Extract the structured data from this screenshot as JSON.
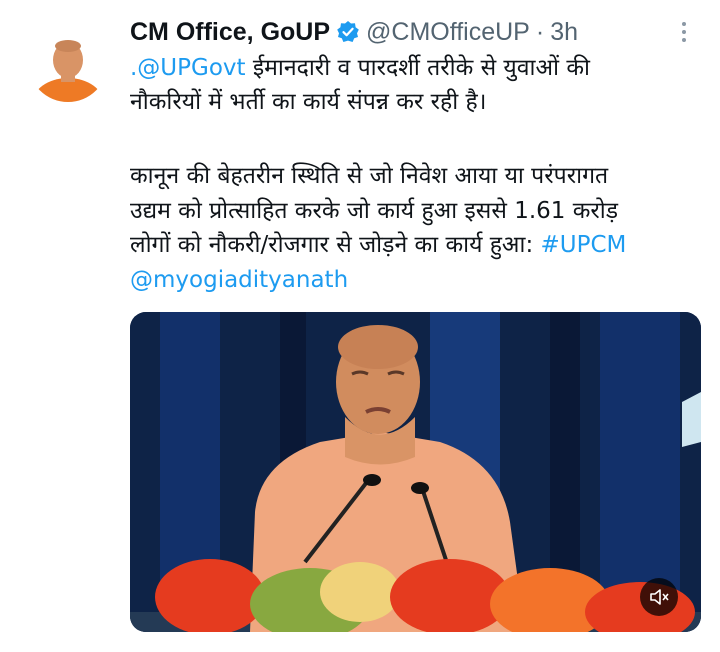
{
  "tweet": {
    "author_name": "CM Office, GoUP",
    "handle": "@CMOfficeUP",
    "separator": "·",
    "time": "3h",
    "text": {
      "mention1": ".@UPGovt",
      "line1_rest": " ईमानदारी व पारदर्शी तरीके से युवाओं की",
      "line2": "नौकरियों में भर्ती का कार्य संपन्न कर रही है।",
      "line3": "कानून की बेहतरीन स्थिति से जो निवेश आया या परंपरागत",
      "line4": "उद्यम को प्रोत्साहित करके जो कार्य हुआ इससे 1.61 करोड़",
      "line5_text": "लोगों को नौकरी/रोजगार से जोड़ने का कार्य हुआ: ",
      "hashtag": "#UPCM",
      "mention2": "@myogiadityanath"
    }
  },
  "colors": {
    "link": "#1d9bf0",
    "verified": "#1d9bf0",
    "stage_background": "#0e2347",
    "kurta": "#f0a77f"
  },
  "icons": {
    "verified": "verified-badge-icon",
    "more": "more-options-icon",
    "mute": "mute-icon"
  }
}
